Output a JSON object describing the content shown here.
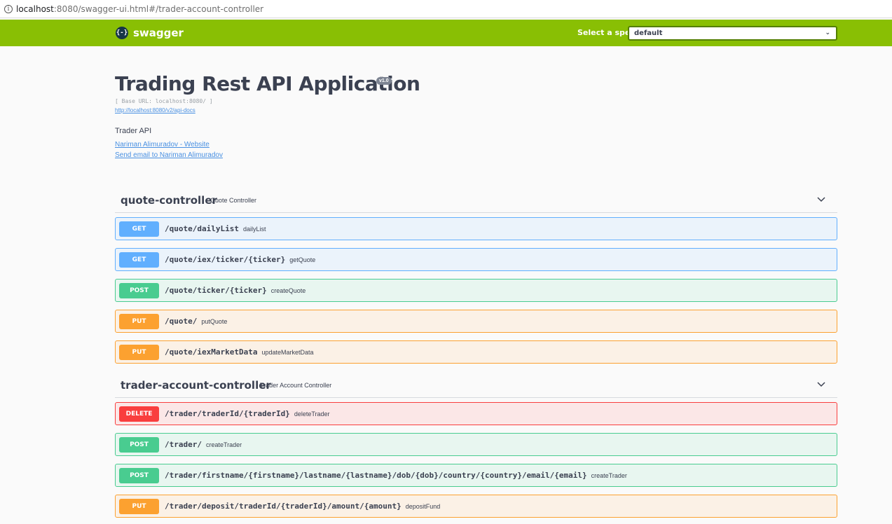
{
  "browser": {
    "url_host": "localhost",
    "url_rest": ":8080/swagger-ui.html#/trader-account-controller"
  },
  "topbar": {
    "logo_icon": "{-}",
    "logo_text": "swagger",
    "spec_label": "Select a spec",
    "spec_value": "default",
    "spec_chevron": "⌄"
  },
  "info": {
    "title": "Trading Rest API Application",
    "version": "v1.0",
    "base_url": "[ Base URL: localhost:8080/ ]",
    "docs_link": "http://localhost:8080/v2/api-docs",
    "description": "Trader API",
    "website_link": "Nariman Alimuradov - Website",
    "email_link": "Send email to Nariman Alimuradov"
  },
  "controllers": [
    {
      "name": "quote-controller",
      "description": "Quote Controller",
      "operations": [
        {
          "method": "GET",
          "path": "/quote/dailyList",
          "summary": "dailyList"
        },
        {
          "method": "GET",
          "path": "/quote/iex/ticker/{ticker}",
          "summary": "getQuote"
        },
        {
          "method": "POST",
          "path": "/quote/ticker/{ticker}",
          "summary": "createQuote"
        },
        {
          "method": "PUT",
          "path": "/quote/",
          "summary": "putQuote"
        },
        {
          "method": "PUT",
          "path": "/quote/iexMarketData",
          "summary": "updateMarketData"
        }
      ]
    },
    {
      "name": "trader-account-controller",
      "description": "Trader Account Controller",
      "operations": [
        {
          "method": "DELETE",
          "path": "/trader/traderId/{traderId}",
          "summary": "deleteTrader"
        },
        {
          "method": "POST",
          "path": "/trader/",
          "summary": "createTrader"
        },
        {
          "method": "POST",
          "path": "/trader/firstname/{firstname}/lastname/{lastname}/dob/{dob}/country/{country}/email/{email}",
          "summary": "createTrader"
        },
        {
          "method": "PUT",
          "path": "/trader/deposit/traderId/{traderId}/amount/{amount}",
          "summary": "depositFund"
        }
      ]
    }
  ],
  "colors": {
    "topbar": "#89bf04",
    "get": "#61affe",
    "post": "#49cc90",
    "put": "#fca130",
    "delete": "#f93e3e",
    "link": "#4990e2"
  },
  "icons": {
    "address_info": "info-icon",
    "collapse": "chevron-down-icon"
  }
}
